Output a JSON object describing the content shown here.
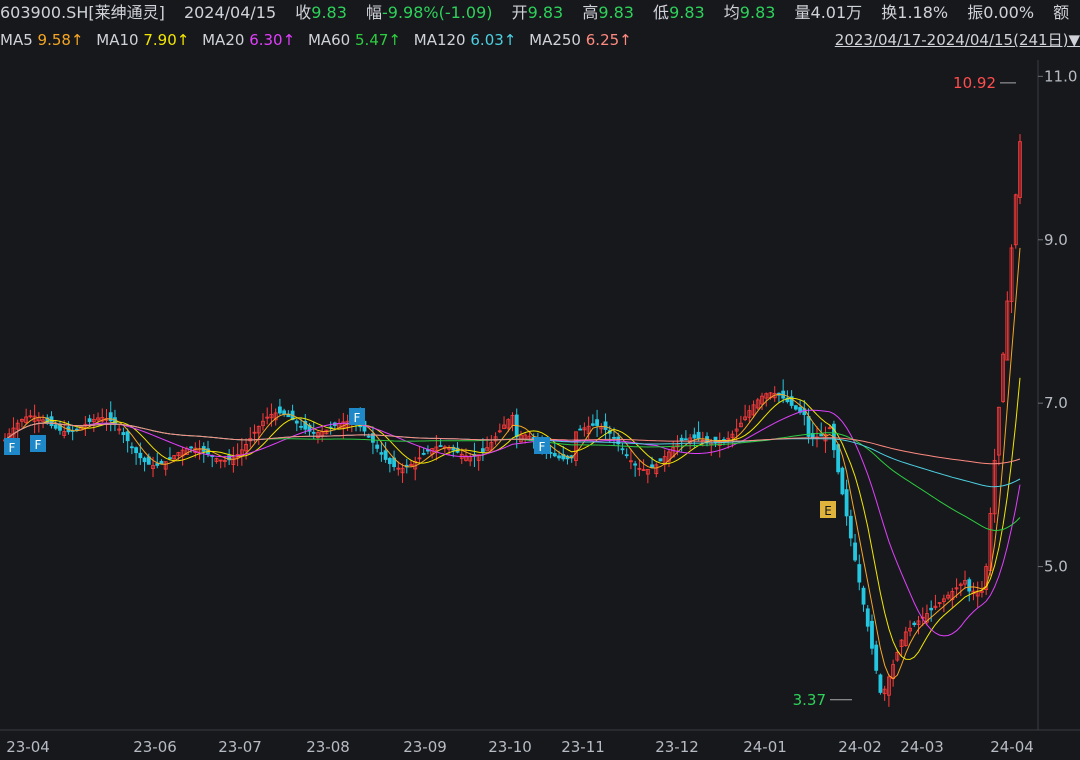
{
  "header": {
    "symbol": "603900.SH[莱绅通灵]",
    "date": "2024/04/15",
    "close_label": "收",
    "close": "9.83",
    "chg_label": "幅",
    "chg": "-9.98%(-1.09)",
    "open_label": "开",
    "open": "9.83",
    "high_label": "高",
    "high": "9.83",
    "low_label": "低",
    "low": "9.83",
    "avg_label": "均",
    "avg": "9.83",
    "vol_label": "量",
    "vol": "4.01万",
    "turn_label": "换",
    "turn": "1.18%",
    "amp_label": "振",
    "amp": "0.00%",
    "amount_label": "额"
  },
  "ma_bar": {
    "items": [
      {
        "label": "MA5",
        "value": "9.58↑",
        "color": "#f5a623"
      },
      {
        "label": "MA10",
        "value": "7.90↑",
        "color": "#f2e600"
      },
      {
        "label": "MA20",
        "value": "6.30↑",
        "color": "#e040fb"
      },
      {
        "label": "MA60",
        "value": "5.47↑",
        "color": "#2ecc40"
      },
      {
        "label": "MA120",
        "value": "6.03↑",
        "color": "#4dd0e1"
      },
      {
        "label": "MA250",
        "value": "6.25↑",
        "color": "#ff8a80"
      }
    ],
    "range": "2023/04/17-2024/04/15(241日)",
    "range_arrow": "▼"
  },
  "chart_data": {
    "type": "candlestick",
    "x_ticks": [
      "23-04",
      "23-06",
      "23-07",
      "23-08",
      "23-09",
      "23-10",
      "23-11",
      "23-12",
      "24-01",
      "24-02",
      "24-03",
      "24-04"
    ],
    "y_ticks": [
      "11.0",
      "9.0",
      "7.0",
      "5.0"
    ],
    "ylim": [
      3.0,
      11.2
    ],
    "high_marker": "10.92",
    "low_marker": "3.37",
    "flags": [
      "F",
      "F",
      "F",
      "F",
      "E"
    ],
    "colors": {
      "up": "#ff3b3b",
      "down": "#25c7e0",
      "grid": "#2a2c33"
    }
  }
}
